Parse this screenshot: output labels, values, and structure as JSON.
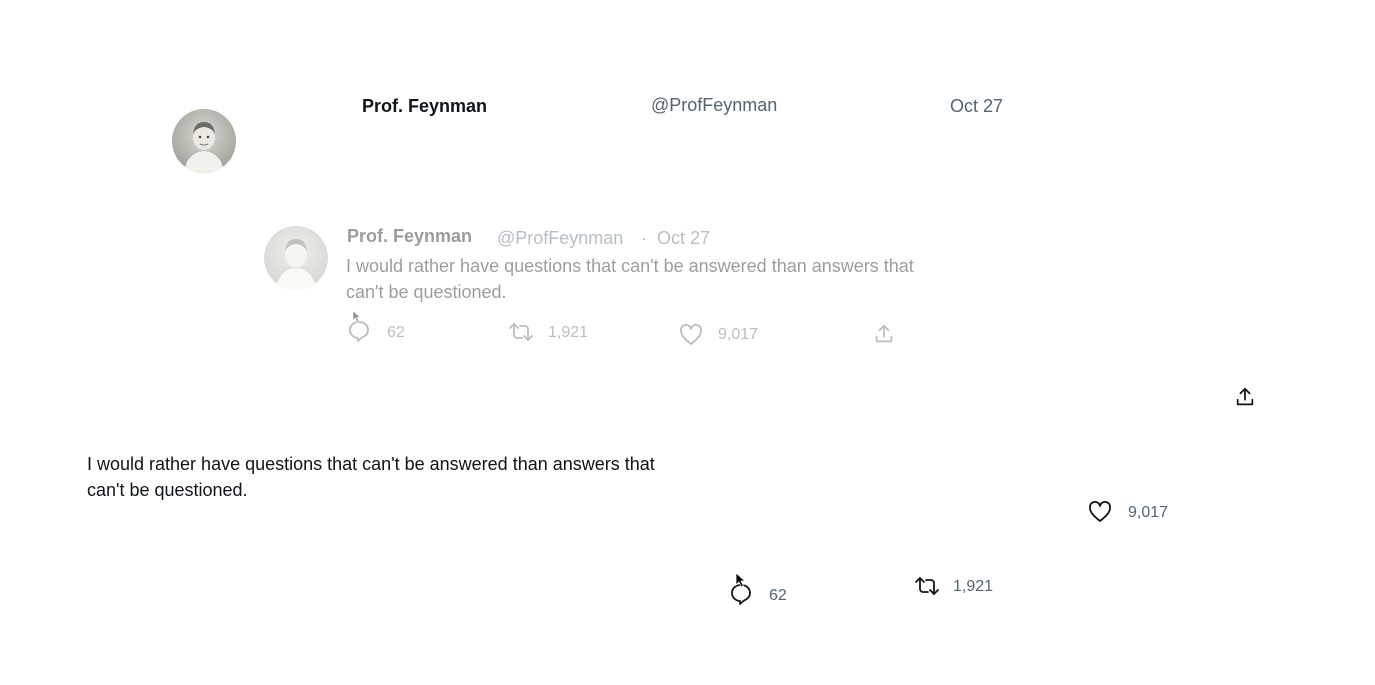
{
  "tweet": {
    "author_name": "Prof. Feynman",
    "handle": "@ProfFeynman",
    "date": "Oct 27",
    "separator": "·",
    "text": "I would rather have questions that can't be answered than answers that can't be questioned.",
    "text_line1": "I would rather have questions that can't be answered than answers that",
    "text_line2": "can't be questioned.",
    "replies": "62",
    "retweets": "1,921",
    "likes": "9,017"
  },
  "icons": {
    "reply": "speech-bubble-icon",
    "retweet": "retweet-arrows-icon",
    "like": "heart-icon",
    "share": "share-upload-icon"
  },
  "colors": {
    "text_primary": "#0f1419",
    "text_secondary": "#536471"
  }
}
